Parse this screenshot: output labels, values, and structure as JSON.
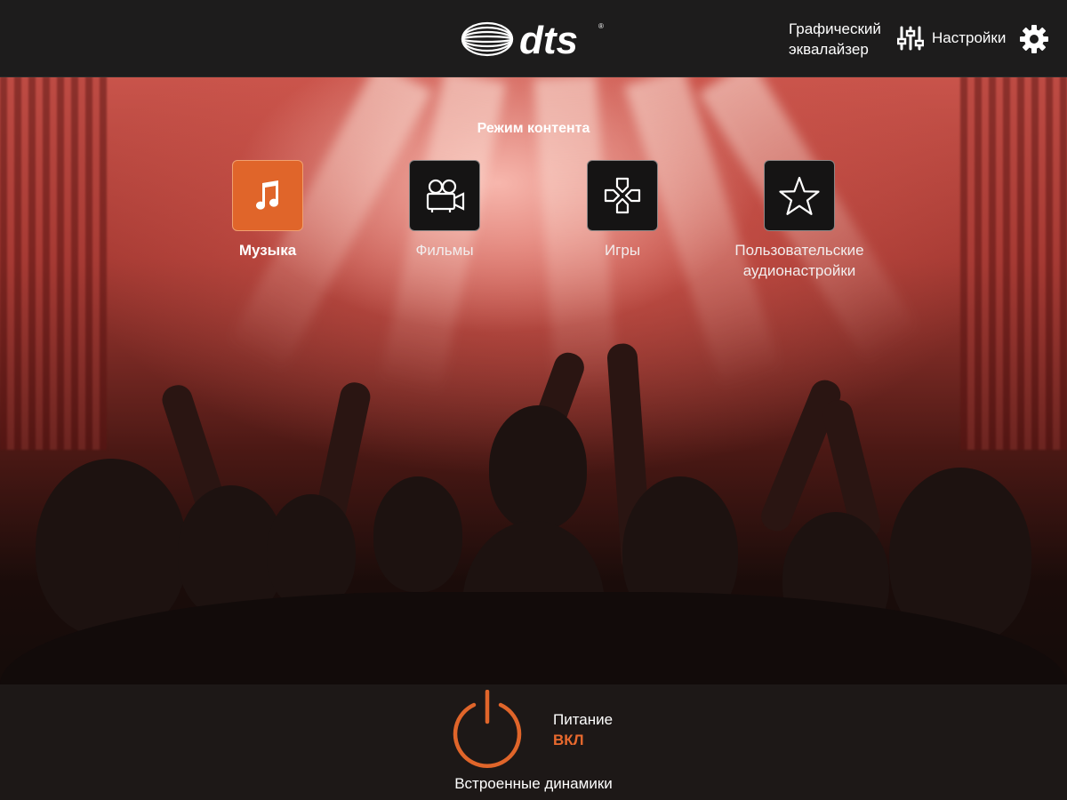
{
  "header": {
    "logo_text": "dts",
    "eq_link_line1": "Графический",
    "eq_link_line2": "эквалайзер",
    "settings_label": "Настройки"
  },
  "content_mode": {
    "title": "Режим контента",
    "items": [
      {
        "label": "Музыка",
        "icon": "music-note-icon",
        "active": true
      },
      {
        "label": "Фильмы",
        "icon": "movie-camera-icon",
        "active": false
      },
      {
        "label": "Игры",
        "icon": "gamepad-icon",
        "active": false
      },
      {
        "label_line1": "Пользовательские",
        "label_line2": "аудионастройки",
        "icon": "star-icon",
        "active": false
      }
    ]
  },
  "power": {
    "label": "Питание",
    "state": "ВКЛ",
    "device": "Встроенные динамики"
  },
  "colors": {
    "accent": "#e0652a",
    "topbar": "#1d1c1c"
  }
}
